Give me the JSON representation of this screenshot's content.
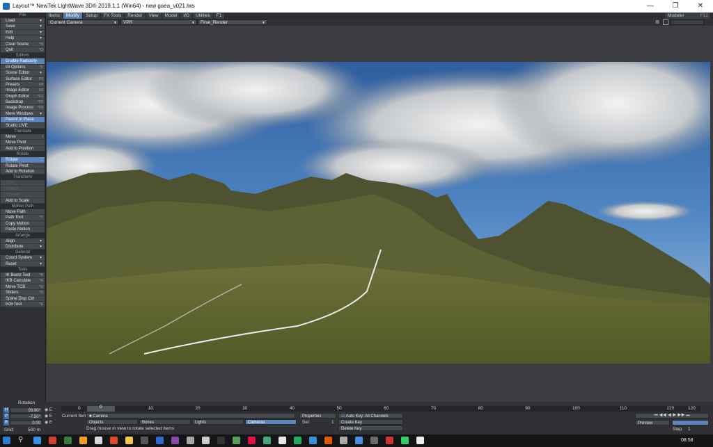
{
  "window": {
    "title": "Layout™ NewTek LightWave 3D® 2019.1.1 (Win64) - new gaea_v021.lws"
  },
  "menu_tabs": [
    "Items",
    "Modify",
    "Setup",
    "FX Tools",
    "Render",
    "View",
    "Model",
    "I/O",
    "Utilities",
    "F1"
  ],
  "modeler_button": {
    "label": "Modeler",
    "key": "F12"
  },
  "viewport_bar": {
    "camera": "Current Camera",
    "view": "VPR",
    "render": "Final_Render"
  },
  "sidebar": {
    "file_header": "File",
    "file_items": [
      {
        "label": "Load",
        "key": ""
      },
      {
        "label": "Save",
        "key": ""
      },
      {
        "label": "Edit",
        "key": ""
      },
      {
        "label": "Help",
        "key": ""
      },
      {
        "label": "Clear Scene",
        "key": "^N"
      },
      {
        "label": "Quit",
        "key": "^Q"
      }
    ],
    "editors_header": "Editors",
    "editors_items": [
      {
        "label": "Enable Radiosity",
        "key": ""
      },
      {
        "label": "GI Options",
        "key": "^F"
      },
      {
        "label": "Scene Editor",
        "key": ""
      },
      {
        "label": "Surface Editor",
        "key": "F5"
      },
      {
        "label": "Presets",
        "key": "F8"
      },
      {
        "label": "Image Editor",
        "key": "F6"
      },
      {
        "label": "Graph Editor",
        "key": "^F2"
      },
      {
        "label": "Backdrop",
        "key": "^F5"
      },
      {
        "label": "Image Process",
        "key": "^F8"
      },
      {
        "label": "More Windows",
        "key": ""
      },
      {
        "label": "Parent in Place",
        "key": ""
      },
      {
        "label": "Studio LIVE",
        "key": ""
      }
    ],
    "translate_header": "Translate",
    "translate_items": [
      {
        "label": "Move",
        "key": "t"
      },
      {
        "label": "Move Pivot",
        "key": ""
      },
      {
        "label": "Add to Position",
        "key": ""
      }
    ],
    "rotate_header": "Rotate",
    "rotate_items": [
      {
        "label": "Rotate",
        "key": "y"
      },
      {
        "label": "Rotate Pivot",
        "key": ""
      },
      {
        "label": "Add to Rotation",
        "key": ""
      }
    ],
    "transform_header": "Transform",
    "transform_items": [
      {
        "label": "Size",
        "key": ""
      },
      {
        "label": "Stretch",
        "key": ""
      },
      {
        "label": "Squash",
        "key": ""
      },
      {
        "label": "Add to Scale",
        "key": ""
      }
    ],
    "motionpath_header": "Motion Path",
    "motionpath_items": [
      {
        "label": "Move Path",
        "key": ""
      },
      {
        "label": "Path Tool",
        "key": "^Y"
      },
      {
        "label": "Copy Motion",
        "key": ""
      },
      {
        "label": "Paste Motion",
        "key": ""
      }
    ],
    "arrange_header": "Arrange",
    "arrange_items": [
      {
        "label": "Align",
        "key": ""
      },
      {
        "label": "Distribute",
        "key": ""
      }
    ],
    "general_header": "General",
    "general_items": [
      {
        "label": "Coord System",
        "key": ""
      },
      {
        "label": "Reset",
        "key": ""
      }
    ],
    "tools_header": "Tools",
    "tools_items": [
      {
        "label": "IK Boost Tool",
        "key": "^B"
      },
      {
        "label": "IKB Calculate",
        "key": "^A"
      },
      {
        "label": "Move TCB",
        "key": "^G"
      },
      {
        "label": "Sliders",
        "key": "^D"
      },
      {
        "label": "Spline Disp Ctrl",
        "key": ""
      },
      {
        "label": "Edit Tool",
        "key": "^E"
      }
    ]
  },
  "bottom": {
    "rotation_label": "Rotation",
    "h_label": "H",
    "h_value": "93.90°",
    "p_label": "P",
    "p_value": "-7.50°",
    "b_label": "B",
    "b_value": "0.00",
    "grid_label": "Grid:",
    "grid_value": "500 m",
    "timeline_ticks": [
      "0",
      "10",
      "20",
      "30",
      "40",
      "50",
      "60",
      "70",
      "80",
      "90",
      "100",
      "110",
      "120"
    ],
    "timeline_start": "0",
    "timeline_end": "120",
    "current_frame": "0",
    "current_item_label": "Current Item",
    "current_item_value": "Camera",
    "objects_label": "Objects",
    "bones_label": "Bones",
    "lights_label": "Lights",
    "cameras_label": "Cameras",
    "properties_label": "Properties",
    "sel_label": "Sel:",
    "sel_value": "1",
    "autokey_label": "Auto Key: All Channels",
    "create_key_label": "Create Key",
    "delete_key_label": "Delete Key",
    "status": "Drag mouse in view to rotate selected items",
    "preview_label": "Preview",
    "step_label": "Step",
    "step_value": "1"
  },
  "taskbar": {
    "time": "08:58"
  }
}
